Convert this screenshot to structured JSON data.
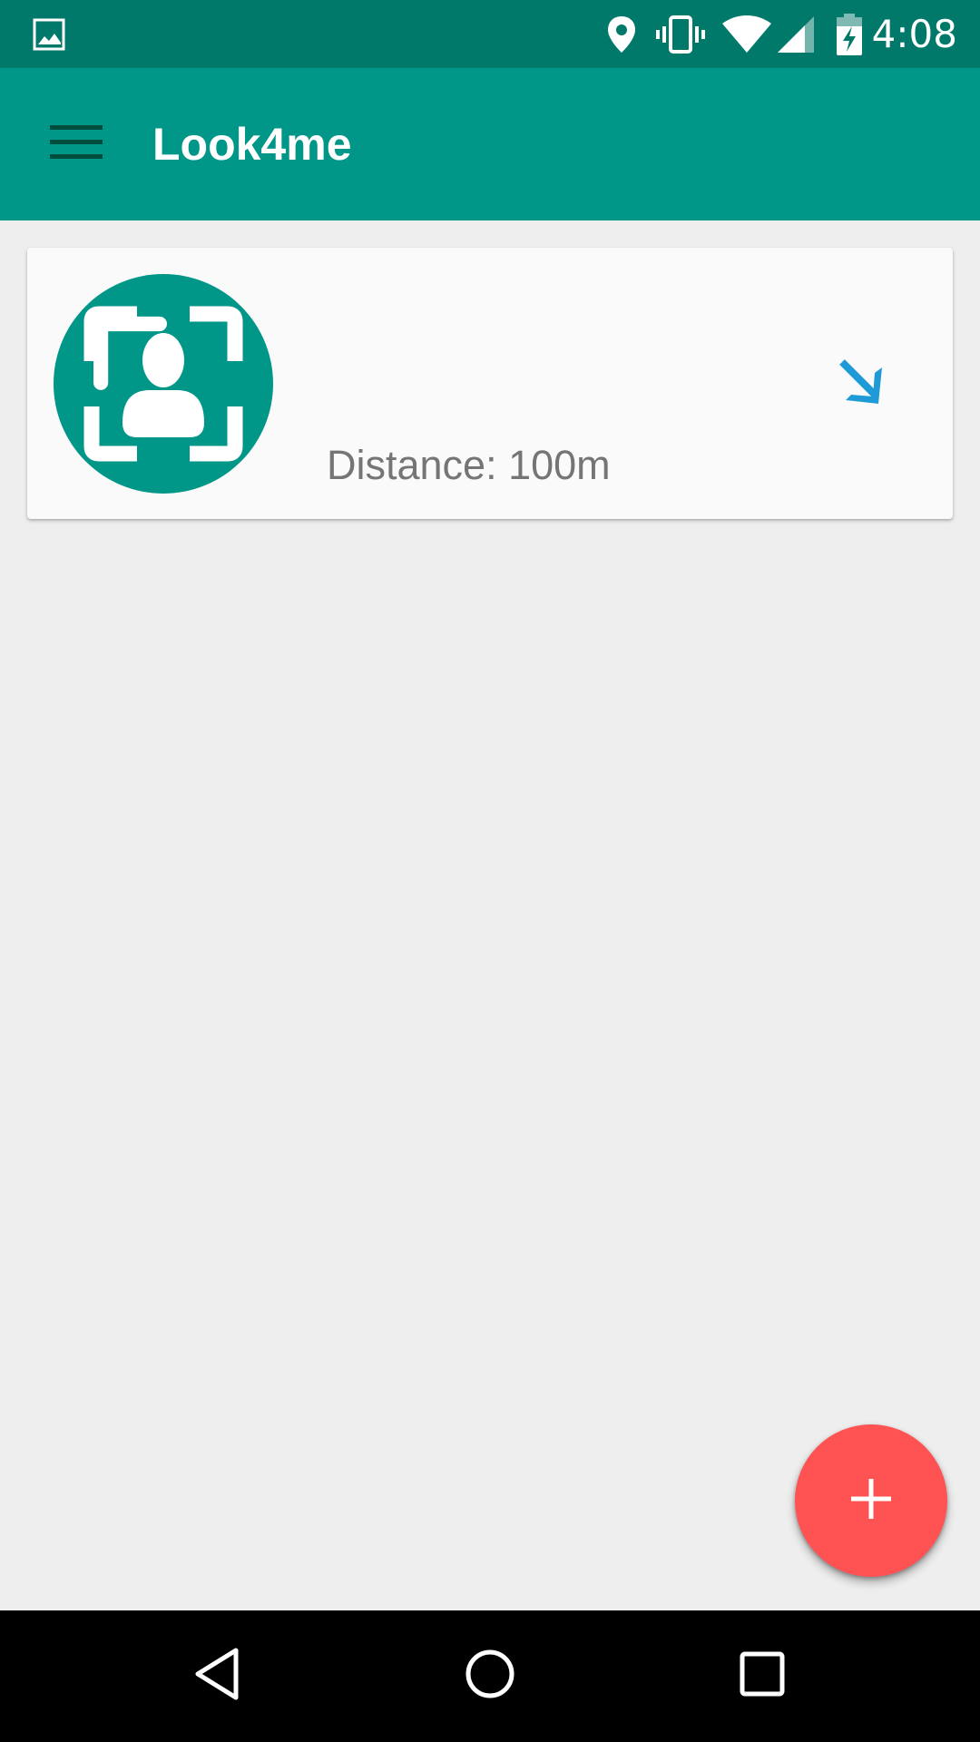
{
  "status_bar": {
    "time": "4:08",
    "icons": [
      "image-notification-icon",
      "location-icon",
      "vibrate-icon",
      "wifi-icon",
      "cell-signal-icon",
      "battery-charging-icon"
    ]
  },
  "app_bar": {
    "title": "Look4me",
    "menu_icon": "hamburger-menu-icon"
  },
  "cards": [
    {
      "avatar_icon": "face-scan-icon",
      "distance_text": "Distance: 100m",
      "direction_icon": "arrow-down-right-icon"
    }
  ],
  "fab": {
    "icon": "plus-icon"
  },
  "nav_bar": {
    "icons": [
      "back-icon",
      "home-icon",
      "recents-icon"
    ]
  },
  "colors": {
    "status_bar": "#00796b",
    "app_bar": "#009688",
    "background": "#eeeeee",
    "card": "#fafafa",
    "avatar": "#009688",
    "direction_arrow": "#1e9ad6",
    "fab": "#ff5252",
    "distance_text": "#757575"
  }
}
